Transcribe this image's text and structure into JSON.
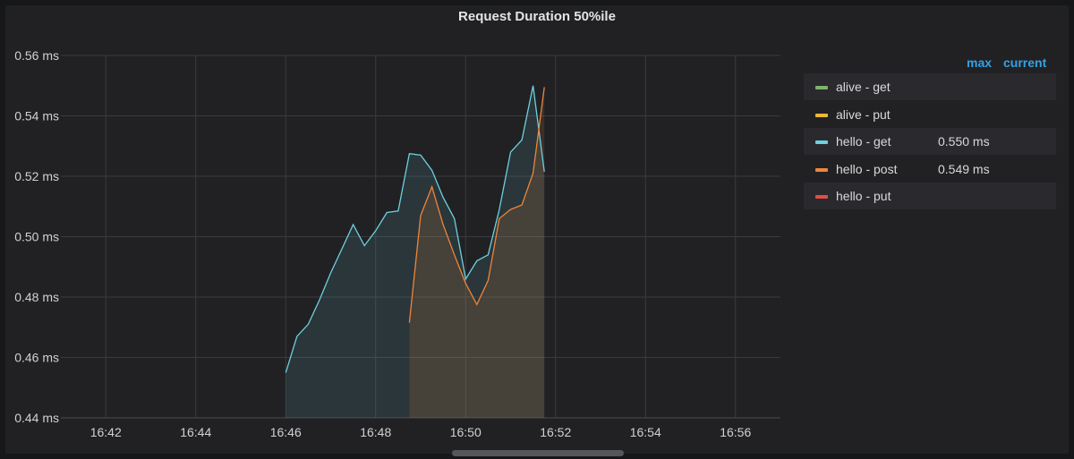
{
  "panel": {
    "title": "Request Duration 50%ile"
  },
  "legend": {
    "header_max": "max",
    "header_current": "current",
    "items": [
      {
        "label": "alive - get",
        "color": "#7eb26d",
        "current": ""
      },
      {
        "label": "alive - put",
        "color": "#eab839",
        "current": ""
      },
      {
        "label": "hello - get",
        "color": "#6ed0e0",
        "current": "0.550 ms"
      },
      {
        "label": "hello - post",
        "color": "#ef843c",
        "current": "0.549 ms"
      },
      {
        "label": "hello - put",
        "color": "#e24d42",
        "current": ""
      }
    ]
  },
  "chart_data": {
    "type": "area",
    "title": "Request Duration 50%ile",
    "x_unit": "time",
    "xlim": [
      "16:41",
      "16:57"
    ],
    "x_ticks": [
      "16:42",
      "16:44",
      "16:46",
      "16:48",
      "16:50",
      "16:52",
      "16:54",
      "16:56"
    ],
    "ylim": [
      0.44,
      0.56
    ],
    "y_ticks": [
      "0.44 ms",
      "0.46 ms",
      "0.48 ms",
      "0.50 ms",
      "0.52 ms",
      "0.54 ms",
      "0.56 ms"
    ],
    "grid": true,
    "legend_position": "right",
    "series": [
      {
        "name": "hello - get",
        "color": "#6ed0e0",
        "x": [
          "16:46:00",
          "16:46:15",
          "16:46:30",
          "16:46:45",
          "16:47:00",
          "16:47:15",
          "16:47:30",
          "16:47:45",
          "16:48:00",
          "16:48:15",
          "16:48:30",
          "16:48:45",
          "16:49:00",
          "16:49:15",
          "16:49:30",
          "16:49:45",
          "16:50:00",
          "16:50:15",
          "16:50:30",
          "16:50:45",
          "16:51:00",
          "16:51:15",
          "16:51:30",
          "16:51:45"
        ],
        "values": [
          0.455,
          0.467,
          0.471,
          0.479,
          0.488,
          0.496,
          0.504,
          0.497,
          0.502,
          0.508,
          0.5085,
          0.5275,
          0.527,
          0.522,
          0.513,
          0.506,
          0.486,
          0.492,
          0.494,
          0.509,
          0.528,
          0.532,
          0.55,
          0.5215
        ]
      },
      {
        "name": "hello - post",
        "color": "#ef843c",
        "x": [
          "16:48:45",
          "16:49:00",
          "16:49:15",
          "16:49:30",
          "16:49:45",
          "16:50:00",
          "16:50:15",
          "16:50:30",
          "16:50:45",
          "16:51:00",
          "16:51:15",
          "16:51:30",
          "16:51:45"
        ],
        "values": [
          0.4715,
          0.507,
          0.5165,
          0.504,
          0.494,
          0.4845,
          0.4775,
          0.4855,
          0.506,
          0.509,
          0.5105,
          0.521,
          0.5495
        ]
      }
    ]
  }
}
